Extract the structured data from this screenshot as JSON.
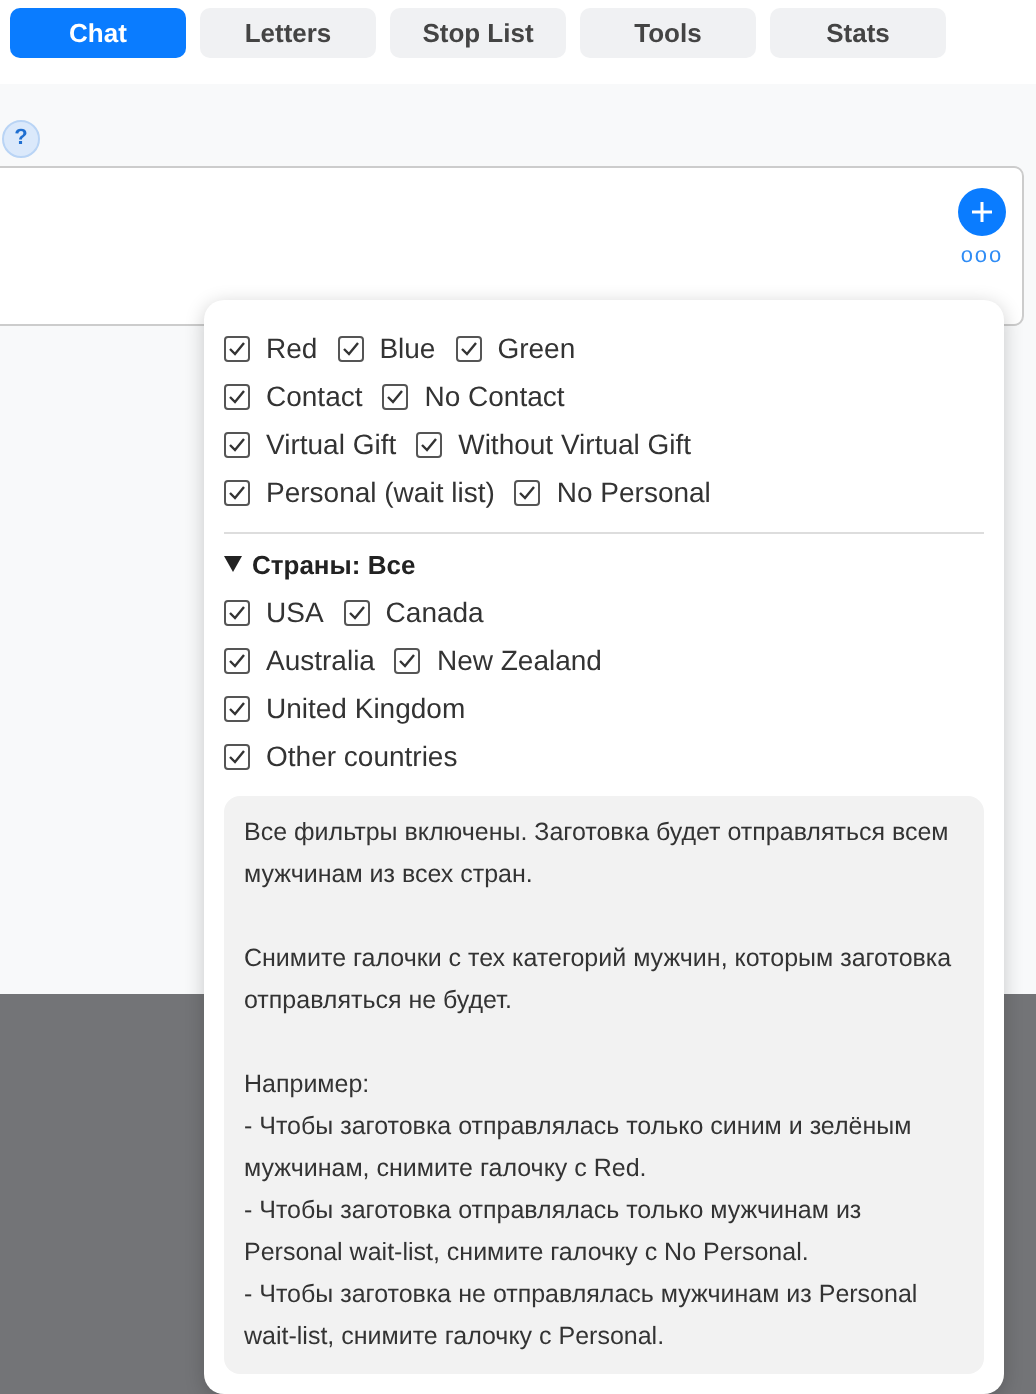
{
  "tabs": [
    {
      "label": "Chat",
      "selected": true
    },
    {
      "label": "Letters",
      "selected": false
    },
    {
      "label": "Stop List",
      "selected": false
    },
    {
      "label": "Tools",
      "selected": false
    },
    {
      "label": "Stats",
      "selected": false
    }
  ],
  "help_badge": "?",
  "composer": {
    "more_label": "ooo"
  },
  "filters": {
    "groups": [
      [
        {
          "label": "Red",
          "checked": true
        },
        {
          "label": "Blue",
          "checked": true
        },
        {
          "label": "Green",
          "checked": true
        }
      ],
      [
        {
          "label": "Contact",
          "checked": true
        },
        {
          "label": "No Contact",
          "checked": true
        }
      ],
      [
        {
          "label": "Virtual Gift",
          "checked": true
        },
        {
          "label": "Without Virtual Gift",
          "checked": true
        }
      ],
      [
        {
          "label": "Personal (wait list)",
          "checked": true
        },
        {
          "label": "No Personal",
          "checked": true
        }
      ]
    ],
    "countries": {
      "title": "Страны: Все",
      "expanded": true,
      "groups": [
        [
          {
            "label": "USA",
            "checked": true
          },
          {
            "label": "Canada",
            "checked": true
          }
        ],
        [
          {
            "label": "Australia",
            "checked": true
          },
          {
            "label": "New Zealand",
            "checked": true
          }
        ],
        [
          {
            "label": "United Kingdom",
            "checked": true
          }
        ],
        [
          {
            "label": "Other countries",
            "checked": true
          }
        ]
      ]
    },
    "hint": [
      "Все фильтры включены. Заготовка будет отправляться всем мужчинам из всех стран.",
      "Снимите галочки с тех категорий мужчин, которым заготовка отправляться не будет.",
      "Например:",
      "- Чтобы заготовка отправлялась только синим и зелёным мужчинам, снимите галочку с Red.",
      "- Чтобы заготовка отправлялась только мужчинам из Personal wait-list, снимите галочку с No Personal.",
      "- Чтобы заготовка не отправлялась мужчинам из Personal wait-list, снимите галочку с Personal."
    ]
  }
}
